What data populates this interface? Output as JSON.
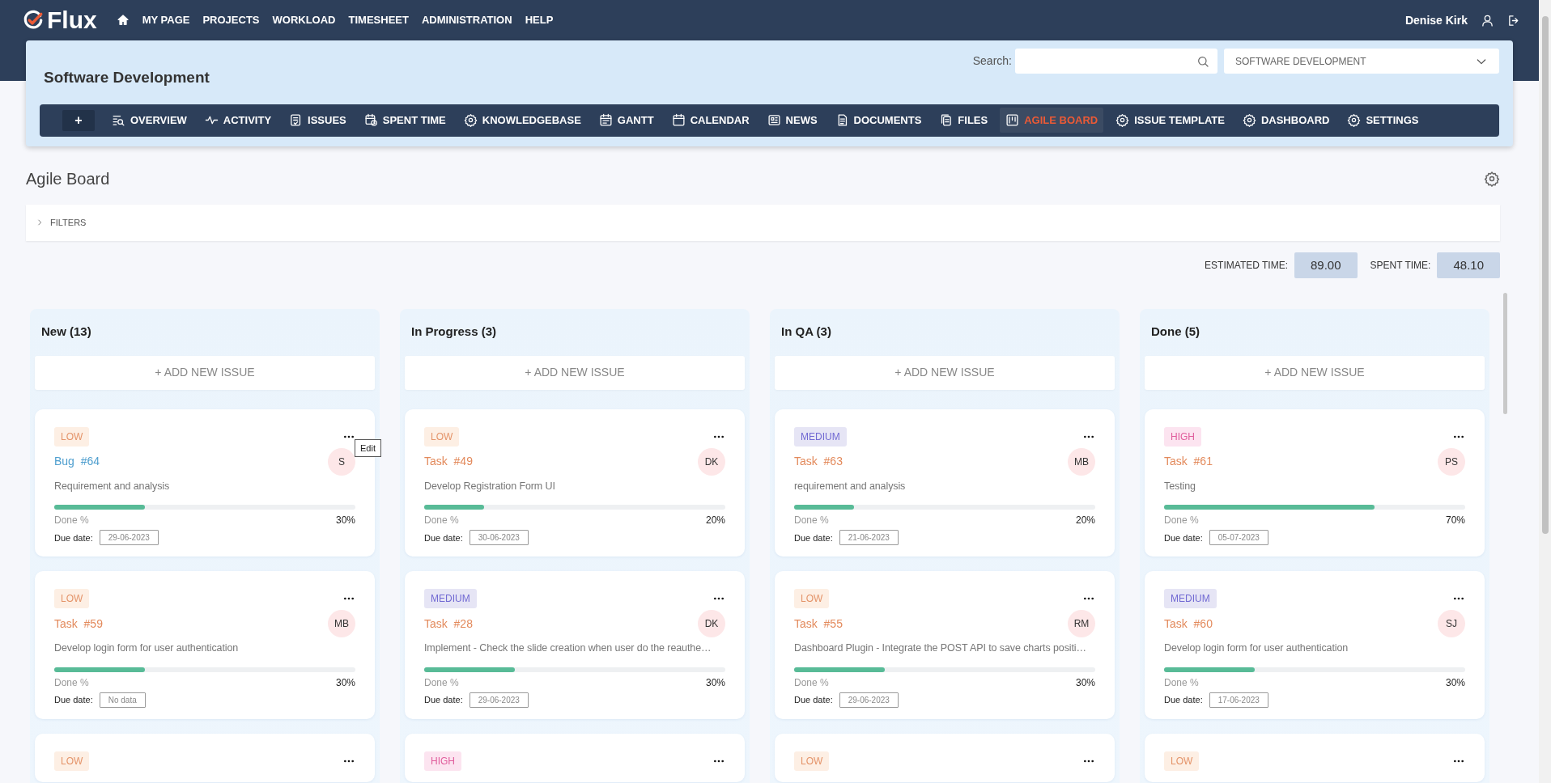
{
  "header": {
    "logo": "Flux",
    "nav": [
      {
        "label": "MY PAGE"
      },
      {
        "label": "PROJECTS"
      },
      {
        "label": "WORKLOAD"
      },
      {
        "label": "TIMESHEET"
      },
      {
        "label": "ADMINISTRATION"
      },
      {
        "label": "HELP"
      }
    ],
    "user": "Denise Kirk"
  },
  "project": {
    "title": "Software Development",
    "search_label": "Search:",
    "project_select": "SOFTWARE DEVELOPMENT",
    "menu": [
      {
        "label": "+",
        "kind": "add",
        "selected": false
      },
      {
        "label": "OVERVIEW",
        "kind": "item",
        "selected": false
      },
      {
        "label": "ACTIVITY",
        "kind": "item",
        "selected": false
      },
      {
        "label": "ISSUES",
        "kind": "item",
        "selected": false
      },
      {
        "label": "SPENT TIME",
        "kind": "item",
        "selected": false
      },
      {
        "label": "KNOWLEDGEBASE",
        "kind": "item",
        "selected": false
      },
      {
        "label": "GANTT",
        "kind": "item",
        "selected": false
      },
      {
        "label": "CALENDAR",
        "kind": "item",
        "selected": false
      },
      {
        "label": "NEWS",
        "kind": "item",
        "selected": false
      },
      {
        "label": "DOCUMENTS",
        "kind": "item",
        "selected": false
      },
      {
        "label": "FILES",
        "kind": "item",
        "selected": false
      },
      {
        "label": "AGILE BOARD",
        "kind": "item",
        "selected": true
      },
      {
        "label": "ISSUE TEMPLATE",
        "kind": "item",
        "selected": false
      },
      {
        "label": "DASHBOARD",
        "kind": "item",
        "selected": false
      },
      {
        "label": "SETTINGS",
        "kind": "item",
        "selected": false
      }
    ]
  },
  "page_title": "Agile Board",
  "filters": {
    "label": "FILTERS",
    "expanded": false
  },
  "totals": [
    {
      "label": "ESTIMATED TIME:",
      "value": "89.00"
    },
    {
      "label": "SPENT TIME:",
      "value": "48.10"
    }
  ],
  "columns": [
    {
      "title": "New (13)",
      "add_label": "+ ADD NEW ISSUE",
      "cards": [
        {
          "priority": "LOW",
          "kind": "bug",
          "tracker_label": "Bug",
          "number": "#64",
          "avatar": "S",
          "subject": "Requirement and analysis",
          "level": 0.3,
          "done_label": "Done %",
          "percent": "30%",
          "due_label": "Due date:",
          "due": "29-06-2023",
          "tooltip": "Edit"
        },
        {
          "priority": "LOW",
          "kind": "task",
          "tracker_label": "Task",
          "number": "#59",
          "avatar": "MB",
          "subject": "Develop login form for user authentication",
          "level": 0.3,
          "done_label": "Done %",
          "percent": "30%",
          "due_label": "Due date:",
          "due": "No data"
        },
        {
          "priority": "LOW"
        }
      ]
    },
    {
      "title": "In Progress (3)",
      "add_label": "+ ADD NEW ISSUE",
      "cards": [
        {
          "priority": "LOW",
          "kind": "task",
          "tracker_label": "Task",
          "number": "#49",
          "avatar": "DK",
          "subject": "Develop Registration Form UI",
          "level": 0.2,
          "done_label": "Done %",
          "percent": "20%",
          "due_label": "Due date:",
          "due": "30-06-2023"
        },
        {
          "priority": "MEDIUM",
          "kind": "task",
          "tracker_label": "Task",
          "number": "#28",
          "avatar": "DK",
          "subject": "Implement - Check the slide creation when user do the reauthe…",
          "level": 0.3,
          "done_label": "Done %",
          "percent": "30%",
          "due_label": "Due date:",
          "due": "29-06-2023"
        },
        {
          "priority": "HIGH"
        }
      ]
    },
    {
      "title": "In QA (3)",
      "add_label": "+ ADD NEW ISSUE",
      "cards": [
        {
          "priority": "MEDIUM",
          "kind": "task",
          "tracker_label": "Task",
          "number": "#63",
          "avatar": "MB",
          "subject": "requirement and analysis",
          "level": 0.2,
          "done_label": "Done %",
          "percent": "20%",
          "due_label": "Due date:",
          "due": "21-06-2023"
        },
        {
          "priority": "LOW",
          "kind": "task",
          "tracker_label": "Task",
          "number": "#55",
          "avatar": "RM",
          "subject": "Dashboard Plugin - Integrate the POST API to save charts positi…",
          "level": 0.3,
          "done_label": "Done %",
          "percent": "30%",
          "due_label": "Due date:",
          "due": "29-06-2023"
        },
        {
          "priority": "LOW"
        }
      ]
    },
    {
      "title": "Done (5)",
      "add_label": "+ ADD NEW ISSUE",
      "cards": [
        {
          "priority": "HIGH",
          "kind": "task",
          "tracker_label": "Task",
          "number": "#61",
          "avatar": "PS",
          "subject": "Testing",
          "level": 0.7,
          "done_label": "Done %",
          "percent": "70%",
          "due_label": "Due date:",
          "due": "05-07-2023"
        },
        {
          "priority": "MEDIUM",
          "kind": "task",
          "tracker_label": "Task",
          "number": "#60",
          "avatar": "SJ",
          "subject": "Develop login form for user authentication",
          "level": 0.3,
          "done_label": "Done %",
          "percent": "30%",
          "due_label": "Due date:",
          "due": "17-06-2023"
        },
        {
          "priority": "LOW"
        }
      ]
    }
  ]
}
